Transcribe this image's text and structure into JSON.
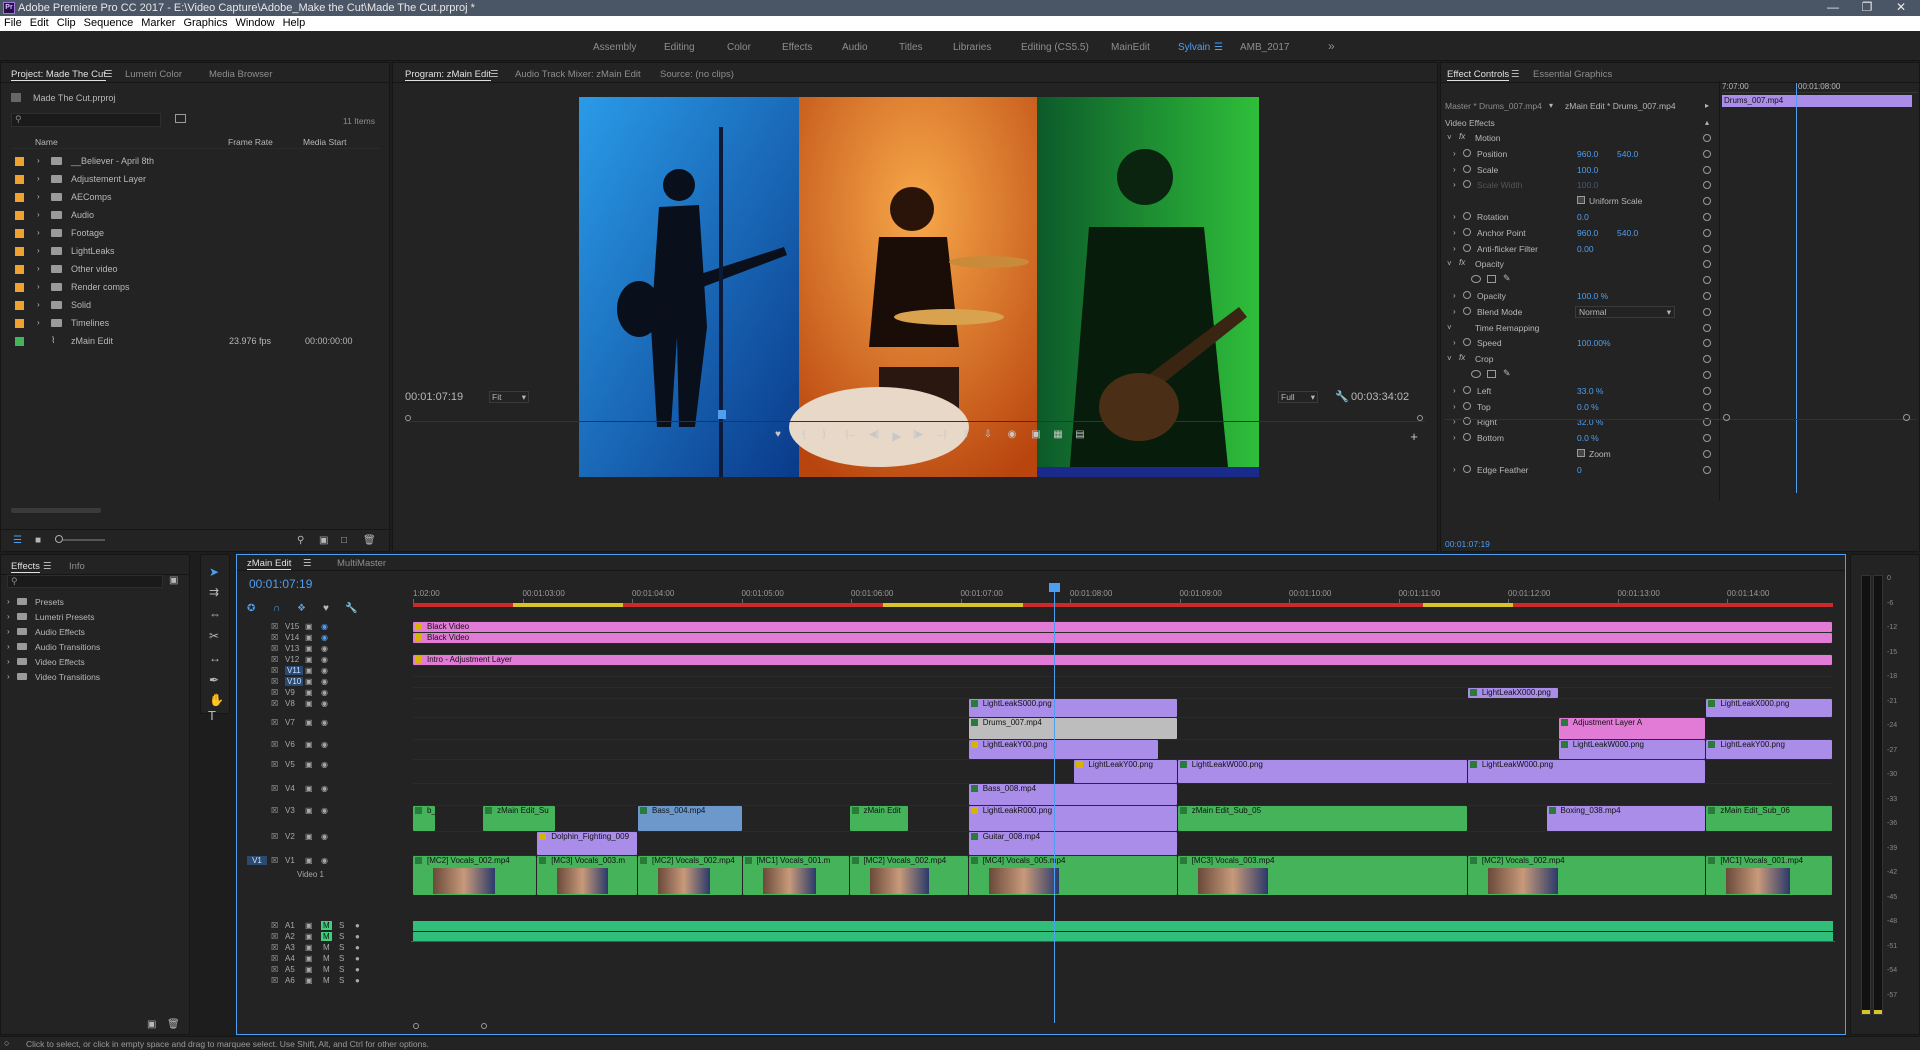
{
  "window": {
    "title": "Adobe Premiere Pro CC 2017 - E:\\Video Capture\\Adobe_Make the Cut\\Made The Cut.prproj *",
    "logo": "Pr"
  },
  "menu": [
    "File",
    "Edit",
    "Clip",
    "Sequence",
    "Marker",
    "Graphics",
    "Window",
    "Help"
  ],
  "workspaces": [
    "Assembly",
    "Editing",
    "Color",
    "Effects",
    "Audio",
    "Titles",
    "Libraries",
    "Editing (CS5.5)",
    "MainEdit",
    "Sylvain",
    "AMB_2017"
  ],
  "active_workspace": "Sylvain",
  "project": {
    "tabs": [
      "Project: Made The Cut",
      "Lumetri Color",
      "Media Browser"
    ],
    "file": "Made The Cut.prproj",
    "items_count": "11 Items",
    "columns": [
      "Name",
      "Frame Rate",
      "Media Start"
    ],
    "items": [
      {
        "name": "__Believer - April 8th",
        "color": "#f0a22e",
        "kind": "folder",
        "fps": "",
        "start": ""
      },
      {
        "name": "Adjustement Layer",
        "color": "#f0a22e",
        "kind": "folder",
        "fps": "",
        "start": ""
      },
      {
        "name": "AEComps",
        "color": "#f0a22e",
        "kind": "folder",
        "fps": "",
        "start": ""
      },
      {
        "name": "Audio",
        "color": "#f0a22e",
        "kind": "folder",
        "fps": "",
        "start": ""
      },
      {
        "name": "Footage",
        "color": "#f0a22e",
        "kind": "folder",
        "fps": "",
        "start": ""
      },
      {
        "name": "LightLeaks",
        "color": "#f0a22e",
        "kind": "folder",
        "fps": "",
        "start": ""
      },
      {
        "name": "Other video",
        "color": "#f0a22e",
        "kind": "folder",
        "fps": "",
        "start": ""
      },
      {
        "name": "Render comps",
        "color": "#f0a22e",
        "kind": "folder",
        "fps": "",
        "start": ""
      },
      {
        "name": "Solid",
        "color": "#f0a22e",
        "kind": "folder",
        "fps": "",
        "start": ""
      },
      {
        "name": "Timelines",
        "color": "#f0a22e",
        "kind": "folder",
        "fps": "",
        "start": ""
      },
      {
        "name": "zMain Edit",
        "color": "#45b35a",
        "kind": "sequence",
        "fps": "23.976 fps",
        "start": "00:00:00:00"
      }
    ]
  },
  "program": {
    "tabs": [
      "Program: zMain Edit",
      "Audio Track Mixer: zMain Edit",
      "Source: (no clips)"
    ],
    "timecode": "00:01:07:19",
    "fit": "Fit",
    "quality": "Full",
    "duration": "00:03:34:02"
  },
  "effect_controls": {
    "tabs": [
      "Effect Controls",
      "Essential Graphics"
    ],
    "master": "Master * Drums_007.mp4",
    "clip": "zMain Edit * Drums_007.mp4",
    "section": "Video Effects",
    "timeline_time": "7:07:00",
    "timeline_time2": "00:01:08:00",
    "clip_bar": "Drums_007.mp4",
    "current_time": "00:01:07:19",
    "rows": [
      {
        "label": "Motion",
        "v1": "",
        "v2": "",
        "indent": 1,
        "fx": true
      },
      {
        "label": "Position",
        "v1": "960.0",
        "v2": "540.0",
        "indent": 2
      },
      {
        "label": "Scale",
        "v1": "100.0",
        "v2": "",
        "indent": 2
      },
      {
        "label": "Scale Width",
        "v1": "100.0",
        "v2": "",
        "indent": 2,
        "dim": true
      },
      {
        "label": "Uniform Scale",
        "v1": "",
        "v2": "",
        "indent": 3,
        "check": true
      },
      {
        "label": "Rotation",
        "v1": "0.0",
        "v2": "",
        "indent": 2
      },
      {
        "label": "Anchor Point",
        "v1": "960.0",
        "v2": "540.0",
        "indent": 2
      },
      {
        "label": "Anti-flicker Filter",
        "v1": "0.00",
        "v2": "",
        "indent": 2
      },
      {
        "label": "Opacity",
        "v1": "",
        "v2": "",
        "indent": 1,
        "fx": true
      },
      {
        "label": "",
        "v1": "",
        "v2": "",
        "indent": 2,
        "shapes": true
      },
      {
        "label": "Opacity",
        "v1": "100.0 %",
        "v2": "",
        "indent": 2
      },
      {
        "label": "Blend Mode",
        "v1": "Normal",
        "v2": "",
        "indent": 2,
        "select": true
      },
      {
        "label": "Time Remapping",
        "v1": "",
        "v2": "",
        "indent": 1
      },
      {
        "label": "Speed",
        "v1": "100.00%",
        "v2": "",
        "indent": 2
      },
      {
        "label": "Crop",
        "v1": "",
        "v2": "",
        "indent": 1,
        "fx": true
      },
      {
        "label": "",
        "v1": "",
        "v2": "",
        "indent": 2,
        "shapes": true
      },
      {
        "label": "Left",
        "v1": "33.0 %",
        "v2": "",
        "indent": 2
      },
      {
        "label": "Top",
        "v1": "0.0 %",
        "v2": "",
        "indent": 2
      },
      {
        "label": "Right",
        "v1": "32.0 %",
        "v2": "",
        "indent": 2
      },
      {
        "label": "Bottom",
        "v1": "0.0 %",
        "v2": "",
        "indent": 2
      },
      {
        "label": "Zoom",
        "v1": "",
        "v2": "",
        "indent": 3,
        "check": true
      },
      {
        "label": "Edge Feather",
        "v1": "0",
        "v2": "",
        "indent": 2
      }
    ]
  },
  "effects_panel": {
    "tabs": [
      "Effects",
      "Info"
    ],
    "items": [
      "Presets",
      "Lumetri Presets",
      "Audio Effects",
      "Audio Transitions",
      "Video Effects",
      "Video Transitions"
    ]
  },
  "timeline": {
    "tabs": [
      "zMain Edit",
      "MultiMaster"
    ],
    "timecode": "00:01:07:19",
    "ruler": [
      "1:02:00",
      "00:01:03:00",
      "00:01:04:00",
      "00:01:05:00",
      "00:01:06:00",
      "00:01:07:00",
      "00:01:08:00",
      "00:01:09:00",
      "00:01:10:00",
      "00:01:11:00",
      "00:01:12:00",
      "00:01:13:00",
      "00:01:14:00"
    ],
    "video_tracks": [
      "V15",
      "V14",
      "V13",
      "V12",
      "V11",
      "V10",
      "V9",
      "V8",
      "V7",
      "V6",
      "V5",
      "V4",
      "V3",
      "V2",
      "V1"
    ],
    "source_patch": "V1",
    "v1_name": "Video 1",
    "audio_tracks": [
      "A1",
      "A2",
      "A3",
      "A4",
      "A5",
      "A6"
    ],
    "clips": [
      {
        "label": "Black Video",
        "track": "V15",
        "start": 0,
        "end": 1155,
        "color": "pink",
        "fx": true
      },
      {
        "label": "Black Video",
        "track": "V14",
        "start": 0,
        "end": 1155,
        "color": "pink",
        "fx": true
      },
      {
        "label": "Intro - Adjustment Layer",
        "track": "V12",
        "start": 0,
        "end": 1155,
        "color": "pink",
        "fx": true
      },
      {
        "label": "LightLeakX000.png",
        "track": "V9",
        "start": 858,
        "end": 932,
        "color": "purple"
      },
      {
        "label": "LightLeakS000.png",
        "track": "V8",
        "start": 452,
        "end": 622,
        "color": "purple"
      },
      {
        "label": "LightLeakX000.png",
        "track": "V8",
        "start": 1052,
        "end": 1155,
        "color": "purple"
      },
      {
        "label": "Drums_007.mp4",
        "track": "V7",
        "start": 452,
        "end": 622,
        "color": "grey"
      },
      {
        "label": "Adjustment Layer A",
        "track": "V7",
        "start": 932,
        "end": 1052,
        "color": "pink"
      },
      {
        "label": "LightLeakY00.png",
        "track": "V6",
        "start": 452,
        "end": 607,
        "color": "purple",
        "fx": true
      },
      {
        "label": "LightLeakW000.png",
        "track": "V6",
        "start": 932,
        "end": 1052,
        "color": "purple"
      },
      {
        "label": "LightLeakY00.png",
        "track": "V6",
        "start": 1052,
        "end": 1155,
        "color": "purple"
      },
      {
        "label": "LightLeakY00.png",
        "track": "V5",
        "start": 538,
        "end": 622,
        "color": "purple",
        "fx": true
      },
      {
        "label": "LightLeakW000.png",
        "track": "V5",
        "start": 622,
        "end": 858,
        "color": "purple"
      },
      {
        "label": "LightLeakW000.png",
        "track": "V5",
        "start": 858,
        "end": 1052,
        "color": "purple"
      },
      {
        "label": "Bass_008.mp4",
        "track": "V4",
        "start": 452,
        "end": 622,
        "color": "purple"
      },
      {
        "label": "b_01",
        "track": "V3",
        "start": 0,
        "end": 19,
        "color": "green"
      },
      {
        "label": "zMain Edit_Su",
        "track": "V3",
        "start": 57,
        "end": 116,
        "color": "green"
      },
      {
        "label": "Bass_004.mp4",
        "track": "V3",
        "start": 183,
        "end": 268,
        "color": "blue"
      },
      {
        "label": "zMain Edit",
        "track": "V3",
        "start": 355,
        "end": 403,
        "color": "green"
      },
      {
        "label": "LightLeakR000.png",
        "track": "V3",
        "start": 452,
        "end": 622,
        "color": "purple",
        "fx": true
      },
      {
        "label": "zMain Edit_Sub_05",
        "track": "V3",
        "start": 622,
        "end": 858,
        "color": "green"
      },
      {
        "label": "Boxing_038.mp4",
        "track": "V3",
        "start": 922,
        "end": 1052,
        "color": "purple"
      },
      {
        "label": "zMain Edit_Sub_06",
        "track": "V3",
        "start": 1052,
        "end": 1155,
        "color": "green"
      },
      {
        "label": "Dolphin_Fighting_009",
        "track": "V2",
        "start": 101,
        "end": 183,
        "color": "purple",
        "fx": true
      },
      {
        "label": "Guitar_008.mp4",
        "track": "V2",
        "start": 452,
        "end": 622,
        "color": "purple"
      },
      {
        "label": "[MC2] Vocals_002.mp4",
        "track": "V1",
        "start": 0,
        "end": 101,
        "color": "green"
      },
      {
        "label": "[MC3] Vocals_003.m",
        "track": "V1",
        "start": 101,
        "end": 183,
        "color": "green"
      },
      {
        "label": "[MC2] Vocals_002.mp4",
        "track": "V1",
        "start": 183,
        "end": 268,
        "color": "green"
      },
      {
        "label": "[MC1] Vocals_001.m",
        "track": "V1",
        "start": 268,
        "end": 355,
        "color": "green"
      },
      {
        "label": "[MC2] Vocals_002.mp4",
        "track": "V1",
        "start": 355,
        "end": 452,
        "color": "green"
      },
      {
        "label": "[MC4] Vocals_005.mp4",
        "track": "V1",
        "start": 452,
        "end": 622,
        "color": "green"
      },
      {
        "label": "[MC3] Vocals_003.mp4",
        "track": "V1",
        "start": 622,
        "end": 858,
        "color": "green"
      },
      {
        "label": "[MC2] Vocals_002.mp4",
        "track": "V1",
        "start": 858,
        "end": 1052,
        "color": "green"
      },
      {
        "label": "[MC1] Vocals_001.mp4",
        "track": "V1",
        "start": 1052,
        "end": 1155,
        "color": "green"
      }
    ]
  },
  "meter_scale": [
    "0",
    "-6",
    "-12",
    "-15",
    "-18",
    "-21",
    "-24",
    "-27",
    "-30",
    "-33",
    "-36",
    "-39",
    "-42",
    "-45",
    "-48",
    "-51",
    "-54",
    "-57"
  ],
  "status": "Click to select, or click in empty space and drag to marquee select. Use Shift, Alt, and Ctrl for other options."
}
